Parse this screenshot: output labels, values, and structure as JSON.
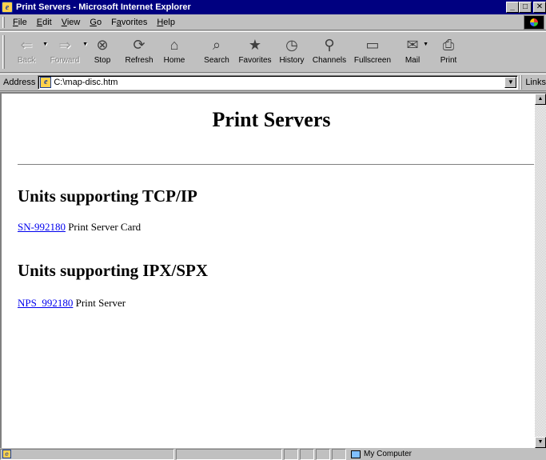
{
  "window": {
    "title": "Print Servers - Microsoft Internet Explorer",
    "controls": {
      "minimize": "_",
      "maximize": "□",
      "close": "✕"
    }
  },
  "menu": [
    {
      "label": "File",
      "accel": "F",
      "rest": "ile"
    },
    {
      "label": "Edit",
      "accel": "E",
      "rest": "dit"
    },
    {
      "label": "View",
      "accel": "V",
      "rest": "iew"
    },
    {
      "label": "Go",
      "accel": "G",
      "rest": "o"
    },
    {
      "label": "Favorites",
      "pre": "F",
      "accel": "a",
      "rest": "vorites"
    },
    {
      "label": "Help",
      "accel": "H",
      "rest": "elp"
    }
  ],
  "toolbar": {
    "back": {
      "label": "Back",
      "icon": "back-arrow-icon",
      "glyph": "⇐"
    },
    "forward": {
      "label": "Forward",
      "icon": "forward-arrow-icon",
      "glyph": "⇒"
    },
    "stop": {
      "label": "Stop",
      "icon": "stop-icon",
      "glyph": "⊗"
    },
    "refresh": {
      "label": "Refresh",
      "icon": "refresh-icon",
      "glyph": "⟳"
    },
    "home": {
      "label": "Home",
      "icon": "home-icon",
      "glyph": "⌂"
    },
    "search": {
      "label": "Search",
      "icon": "search-icon",
      "glyph": "⌕"
    },
    "favorites": {
      "label": "Favorites",
      "icon": "favorites-icon",
      "glyph": "★"
    },
    "history": {
      "label": "History",
      "icon": "history-icon",
      "glyph": "◷"
    },
    "channels": {
      "label": "Channels",
      "icon": "channels-icon",
      "glyph": "⚲"
    },
    "fullscreen": {
      "label": "Fullscreen",
      "icon": "fullscreen-icon",
      "glyph": "▭"
    },
    "mail": {
      "label": "Mail",
      "icon": "mail-icon",
      "glyph": "✉"
    },
    "print": {
      "label": "Print",
      "icon": "print-icon",
      "glyph": "⎙"
    }
  },
  "address": {
    "label": "Address",
    "url": "C:\\map-disc.htm",
    "links_label": "Links"
  },
  "page": {
    "title": "Print Servers",
    "sections": [
      {
        "heading": "Units supporting TCP/IP",
        "link_text": "SN-992180",
        "text": " Print Server Card"
      },
      {
        "heading": "Units supporting IPX/SPX",
        "link_text": "NPS_992180",
        "text": " Print Server"
      }
    ]
  },
  "status": {
    "zone": "My Computer"
  },
  "colors": {
    "titlebar": "#000080",
    "chrome": "#c0c0c0",
    "link": "#0000ee"
  }
}
